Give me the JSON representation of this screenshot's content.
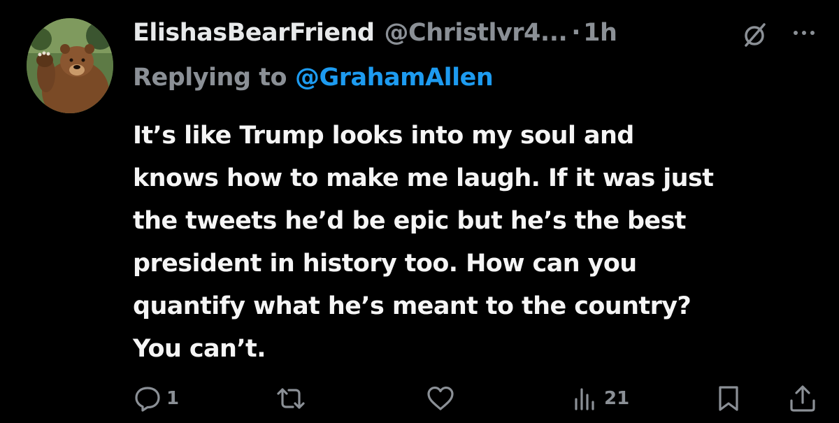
{
  "tweet": {
    "display_name": "ElishasBearFriend",
    "handle": "@Christlvr4...",
    "separator": "·",
    "time": "1h",
    "replying_prefix": "Replying to",
    "replying_to": "@GrahamAllen",
    "text_lines": [
      "It’s like Trump looks into my soul and",
      "knows how to make me laugh. If it was just",
      "the tweets he’d be epic but he’s the best",
      "president in history too. How can you",
      "quantify what he’s meant to the country?",
      "You can’t."
    ]
  },
  "actions": {
    "reply_count": "1",
    "retweet_count": "",
    "like_count": "",
    "views_count": "21"
  },
  "icons": {
    "grok": "grok-icon",
    "more": "more-icon",
    "reply": "reply-icon",
    "retweet": "retweet-icon",
    "like": "heart-icon",
    "views": "views-icon",
    "bookmark": "bookmark-icon",
    "share": "share-icon"
  },
  "colors": {
    "background": "#000000",
    "text_primary": "#e7e9ea",
    "text_secondary": "#8b9096",
    "link": "#1d9bf0"
  }
}
